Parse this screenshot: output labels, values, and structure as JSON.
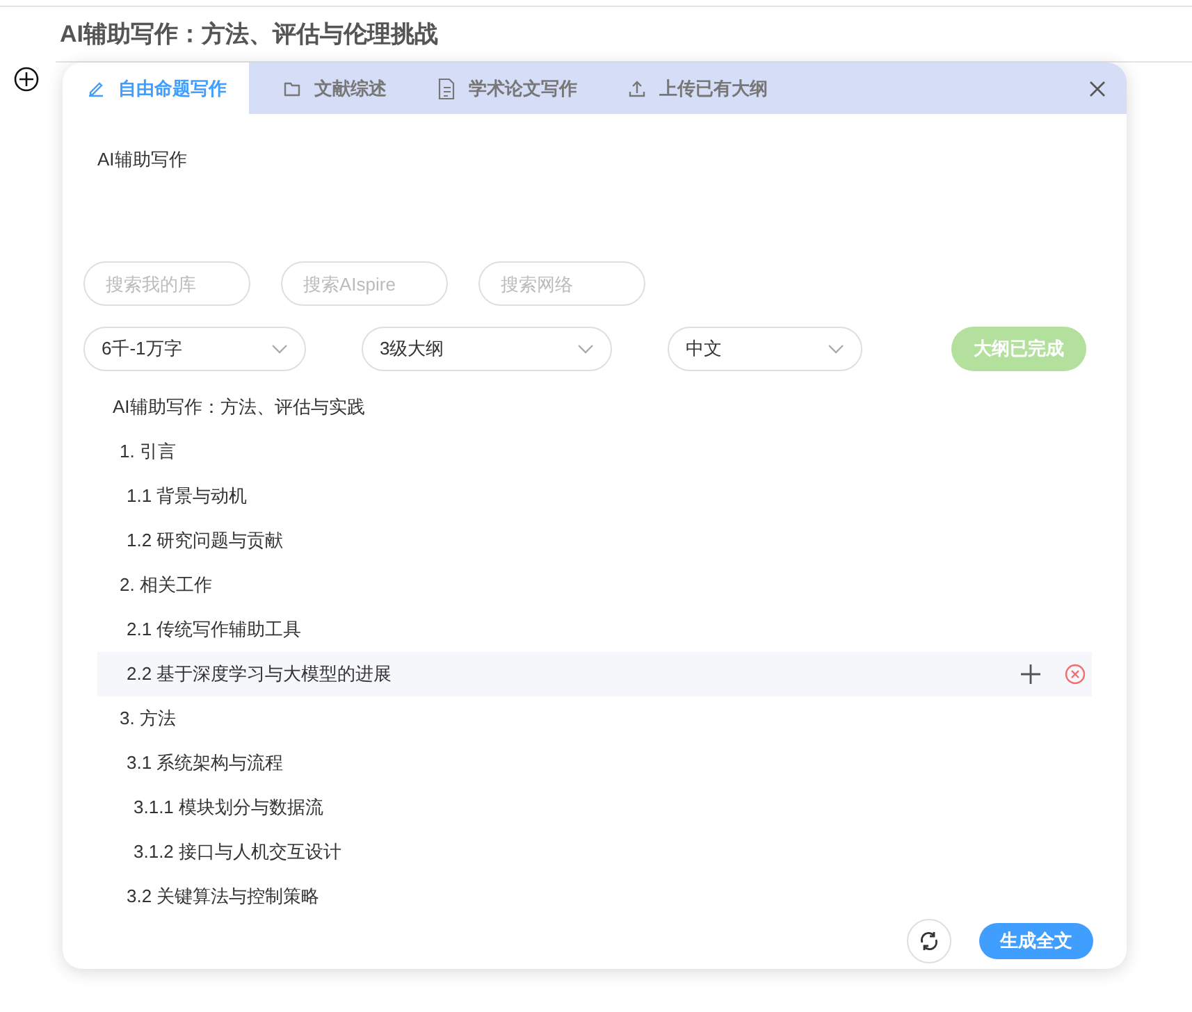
{
  "document": {
    "title": "AI辅助写作：方法、评估与伦理挑战"
  },
  "dialog": {
    "tabs": [
      {
        "label": "自由命题写作",
        "kind": "pen",
        "selected": true
      },
      {
        "label": "文献综述",
        "kind": "folder",
        "selected": false
      },
      {
        "label": "学术论文写作",
        "kind": "document",
        "selected": false
      },
      {
        "label": "上传已有大纲",
        "kind": "upload",
        "selected": false
      }
    ],
    "topic": "AI辅助写作",
    "search_fields": [
      {
        "placeholder": "搜索我的库"
      },
      {
        "placeholder": "搜索AIspire"
      },
      {
        "placeholder": "搜索网络"
      }
    ],
    "selects": [
      {
        "value": "6千-1万字"
      },
      {
        "value": "3级大纲"
      },
      {
        "value": "中文"
      }
    ],
    "outline_button": {
      "label": "大纲已完成",
      "disabled": true
    },
    "outline": [
      {
        "label": "AI辅助写作：方法、评估与实践",
        "selected": false,
        "children": [
          {
            "label": "1. 引言",
            "selected": false,
            "children": [
              {
                "label": "1.1 背景与动机",
                "selected": false
              },
              {
                "label": "1.2 研究问题与贡献",
                "selected": false
              }
            ]
          },
          {
            "label": "2. 相关工作",
            "selected": false,
            "children": [
              {
                "label": "2.1 传统写作辅助工具",
                "selected": false
              },
              {
                "label": "2.2 基于深度学习与大模型的进展",
                "selected": true
              }
            ]
          },
          {
            "label": "3. 方法",
            "selected": false,
            "children": [
              {
                "label": "3.1 系统架构与流程",
                "selected": false,
                "children": [
                  {
                    "label": "3.1.1 模块划分与数据流",
                    "selected": false
                  },
                  {
                    "label": "3.1.2 接口与人机交互设计",
                    "selected": false
                  }
                ]
              },
              {
                "label": "3.2 关键算法与控制策略",
                "selected": false
              }
            ]
          }
        ]
      }
    ],
    "generate_button": {
      "label": "生成全文"
    }
  }
}
